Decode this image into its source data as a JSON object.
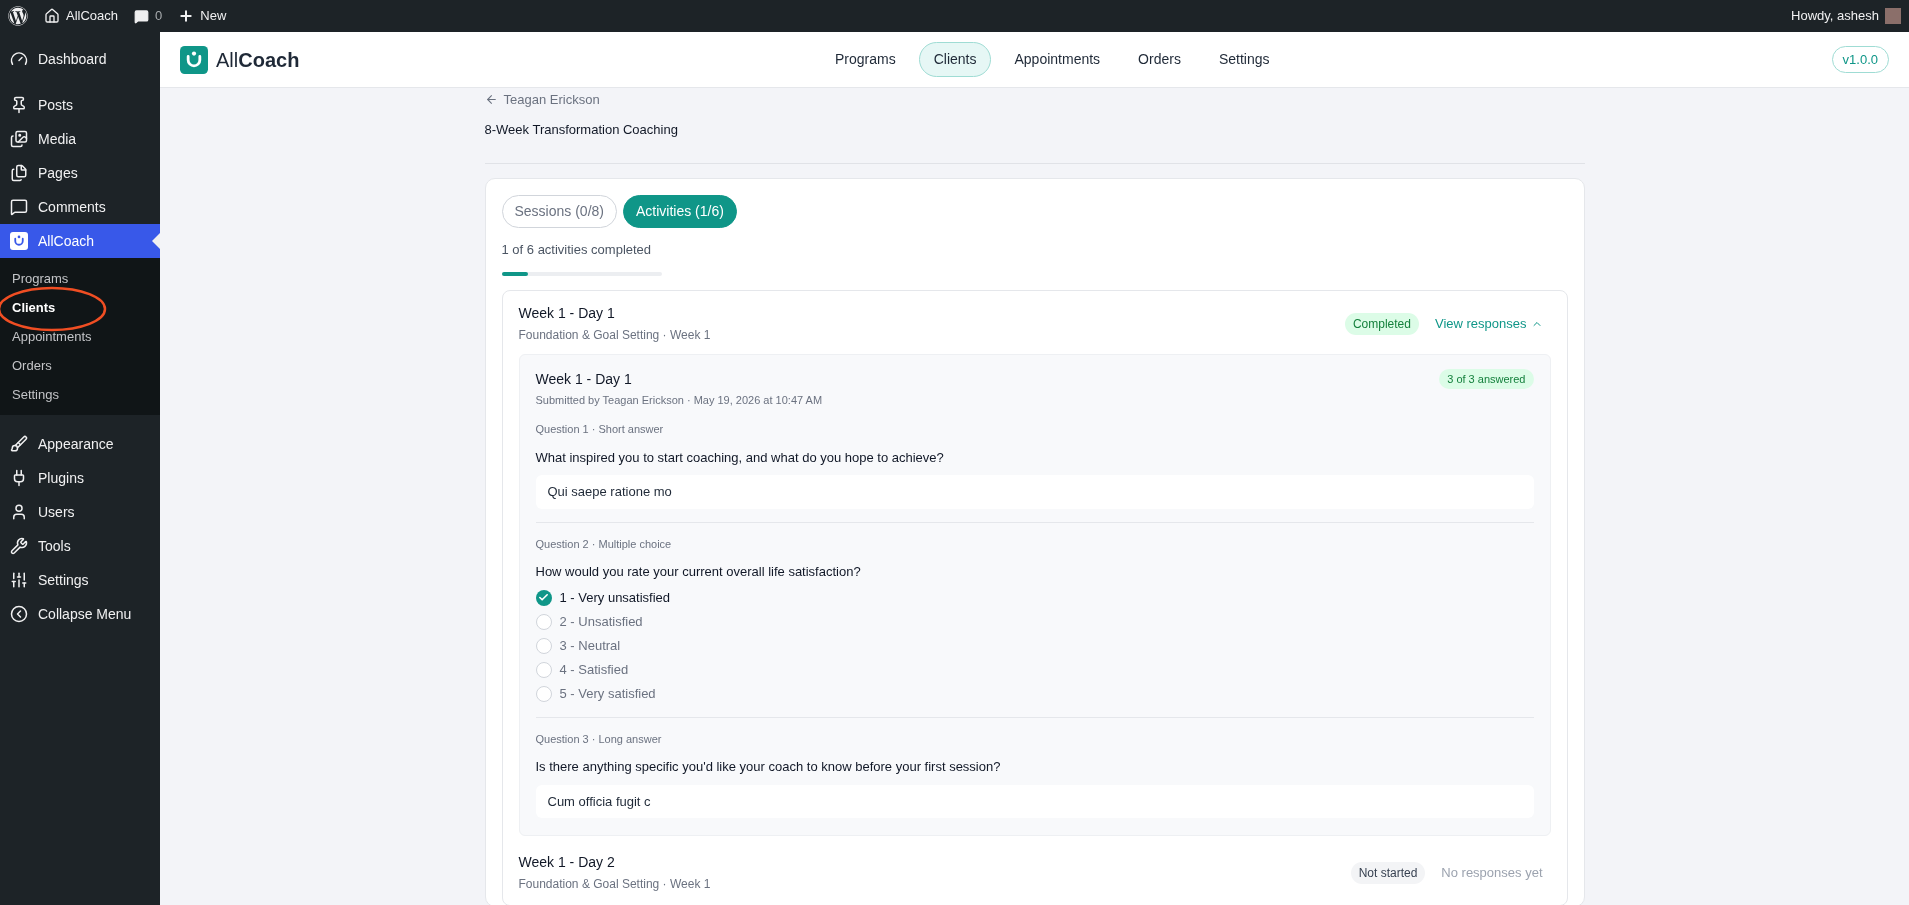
{
  "admin_bar": {
    "site": "AllCoach",
    "comments": "0",
    "new": "New",
    "greeting": "Howdy, ashesh"
  },
  "sidebar": {
    "items": [
      {
        "label": "Dashboard",
        "selected": false
      },
      {
        "label": "Posts",
        "selected": false
      },
      {
        "label": "Media",
        "selected": false
      },
      {
        "label": "Pages",
        "selected": false
      },
      {
        "label": "Comments",
        "selected": false
      },
      {
        "label": "AllCoach",
        "selected": true,
        "children": [
          {
            "label": "Programs",
            "selected": false
          },
          {
            "label": "Clients",
            "selected": true
          },
          {
            "label": "Appointments",
            "selected": false
          },
          {
            "label": "Orders",
            "selected": false
          },
          {
            "label": "Settings",
            "selected": false
          }
        ]
      },
      {
        "label": "Appearance",
        "selected": false
      },
      {
        "label": "Plugins",
        "selected": false
      },
      {
        "label": "Users",
        "selected": false
      },
      {
        "label": "Tools",
        "selected": false
      },
      {
        "label": "Settings",
        "selected": false
      },
      {
        "label": "Collapse Menu",
        "selected": false
      }
    ]
  },
  "header": {
    "brand_light": "All",
    "brand_bold": "Coach",
    "nav": [
      {
        "label": "Programs",
        "selected": false
      },
      {
        "label": "Clients",
        "selected": true
      },
      {
        "label": "Appointments",
        "selected": false
      },
      {
        "label": "Orders",
        "selected": false
      },
      {
        "label": "Settings",
        "selected": false
      }
    ],
    "version": "v1.0.0"
  },
  "back_link": "Teagan Erickson",
  "program_title": "8-Week Transformation Coaching",
  "tabs": [
    {
      "label": "Sessions (0/8)",
      "selected": false
    },
    {
      "label": "Activities (1/6)",
      "selected": true
    }
  ],
  "progress": {
    "text": "1 of 6 activities completed",
    "level": 0.167
  },
  "activities": [
    {
      "title": "Week 1 - Day 1",
      "subtitle": "Foundation & Goal Setting · Week 1",
      "status": {
        "label": "Completed",
        "kind": "completed"
      },
      "link": {
        "label": "View responses",
        "expanded": true
      },
      "response": {
        "title": "Week 1 - Day 1",
        "submitted": "Submitted by Teagan Erickson · May 19, 2026 at 10:47 AM",
        "badge": "3 of 3 answered",
        "questions": [
          {
            "kind": "text",
            "label": "Question 1 · Short answer",
            "prompt": "What inspired you to start coaching, and what do you hope to achieve?",
            "answer": "Qui saepe ratione mo"
          },
          {
            "kind": "choice",
            "label": "Question 2 · Multiple choice",
            "prompt": "How would you rate your current overall life satisfaction?",
            "options": [
              {
                "label": "1 - Very unsatisfied",
                "selected": true
              },
              {
                "label": "2 - Unsatisfied",
                "selected": false
              },
              {
                "label": "3 - Neutral",
                "selected": false
              },
              {
                "label": "4 - Satisfied",
                "selected": false
              },
              {
                "label": "5 - Very satisfied",
                "selected": false
              }
            ]
          },
          {
            "kind": "text",
            "label": "Question 3 · Long answer",
            "prompt": "Is there anything specific you'd like your coach to know before your first session?",
            "answer": "Cum officia fugit c"
          }
        ]
      }
    },
    {
      "title": "Week 1 - Day 2",
      "subtitle": "Foundation & Goal Setting · Week 1",
      "status": {
        "label": "Not started",
        "kind": "not_started"
      },
      "note": "No responses yet"
    }
  ]
}
